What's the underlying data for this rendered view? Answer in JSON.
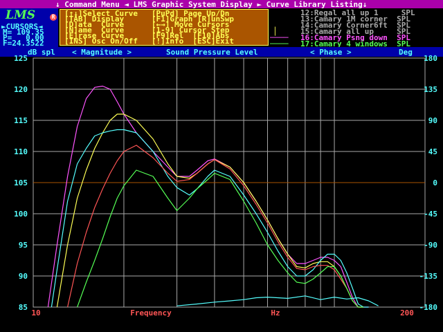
{
  "titlebar": {
    "text": "↓ Command Menu ◄ LMS Graphic System Display ► Curve Library Listing↓"
  },
  "logo": {
    "text": "LMS",
    "mark": "R"
  },
  "cursors": {
    "header": "►CURSORS◄",
    "m": "M= 109.35",
    "p": "P=   0.00",
    "f": "F=24.3522"
  },
  "command_menu": [
    "[↑↓]Select Curve   [PuPd] Page Up/Dn",
    "[TAB] Display      [F1]Graph [R]unSwp",
    "[D]ata  Curve      [←→] Move Cursors",
    "[N]ame  Curve      [1-9] Cursor Step",
    "[E]rase Curve      [F9]Rel  [F10]Abs",
    "[INS] Osc On/Off   [!]Info  [ESC]Exit"
  ],
  "library": [
    {
      "text": "12:Regal all up 1     SPL",
      "color": "#aaaaaa",
      "marker": ""
    },
    {
      "text": "13:Camary 1M corner  SPL",
      "color": "#aaaaaa",
      "marker": ""
    },
    {
      "text": "14:Camary Corner6ft  SPL",
      "color": "#aaaaaa",
      "marker": ""
    },
    {
      "text": "15:Camary all up     SPL",
      "color": "#aaaaaa",
      "marker": "│"
    },
    {
      "text": "16:Camary Psng down  SPL",
      "color": "#ff55ff",
      "marker": "────"
    },
    {
      "text": "17:Camary 4 windows  SPL",
      "color": "#55ff55",
      "marker": "────"
    }
  ],
  "magbar": {
    "left_unit": "dB spl",
    "magnitude": "< Magnitude >",
    "title": "Sound Pressure Level",
    "phase": "< Phase >",
    "right_unit": "Deg"
  },
  "chart_data": {
    "type": "line",
    "title": "Sound Pressure Level",
    "xlabel": "Frequency",
    "xunit": "Hz",
    "ylabel": "dB spl",
    "y2label": "Deg",
    "xscale": "log",
    "xlim": [
      10,
      200
    ],
    "ylim": [
      85,
      125
    ],
    "y2lim": [
      -180,
      180
    ],
    "x_tick_labels": [
      "10",
      "200"
    ],
    "y_ticks": [
      85,
      90,
      95,
      100,
      105,
      110,
      115,
      120,
      125
    ],
    "y2_ticks": [
      180,
      135,
      90,
      45,
      0,
      -45,
      -90,
      -135,
      -180
    ],
    "reference_level": 105,
    "grid": true,
    "series": [
      {
        "color": "#ff55ff",
        "x": [
          11.2,
          12,
          13,
          14,
          15,
          16,
          17,
          18,
          19,
          20,
          22,
          25,
          28,
          30,
          33,
          35,
          38,
          40,
          45,
          50,
          55,
          60,
          65,
          70,
          75,
          80,
          85,
          90,
          95,
          100,
          105,
          110,
          115,
          120,
          125,
          130
        ],
        "y": [
          85,
          95,
          106,
          114,
          118.5,
          120.3,
          120.5,
          120,
          118,
          116,
          113,
          110,
          107.5,
          106,
          106,
          107,
          108.5,
          108.8,
          107.5,
          105,
          102,
          99,
          96,
          93.5,
          92,
          92,
          92.5,
          93,
          93,
          92.5,
          91.5,
          89,
          86.5,
          85,
          85,
          85
        ]
      },
      {
        "color": "#ffff55",
        "x": [
          12,
          13,
          14,
          15,
          16,
          17,
          18,
          19,
          20,
          22,
          25,
          28,
          30,
          33,
          35,
          38,
          40,
          45,
          50,
          55,
          60,
          65,
          70,
          75,
          80,
          85,
          90,
          95,
          100,
          105,
          110,
          115,
          120,
          125
        ],
        "y": [
          85,
          95,
          102.5,
          107,
          110.5,
          113,
          115,
          116,
          116,
          115,
          112,
          108,
          106,
          105.7,
          106.5,
          108,
          108.7,
          107.5,
          105,
          102,
          99,
          96,
          93.5,
          91.5,
          91.3,
          92,
          92.3,
          92.3,
          91.5,
          90,
          88,
          86,
          85,
          85
        ]
      },
      {
        "color": "#55ffff",
        "x": [
          11.5,
          12,
          13,
          14,
          15,
          16,
          17,
          18,
          19,
          20,
          22,
          25,
          28,
          30,
          33,
          35,
          38,
          40,
          45,
          50,
          55,
          60,
          65,
          70,
          75,
          80,
          85,
          90,
          95,
          100,
          105,
          110,
          115,
          120,
          125,
          130
        ],
        "y": [
          85,
          91,
          102,
          108,
          110.5,
          112.5,
          113,
          113.3,
          113.5,
          113.5,
          113,
          110,
          106,
          104.2,
          103,
          104,
          106,
          107,
          106,
          103,
          100,
          97,
          94,
          91.5,
          90,
          90,
          91,
          92.5,
          93.5,
          93.5,
          92.5,
          90.5,
          88,
          85.5,
          85,
          85
        ]
      },
      {
        "color": "#ff5555",
        "x": [
          13,
          14,
          15,
          16,
          17,
          18,
          19,
          20,
          22,
          25,
          28,
          30,
          33,
          35,
          38,
          40,
          45,
          50,
          55,
          60,
          65,
          70,
          75,
          80,
          85,
          90,
          95,
          100,
          105,
          110,
          115,
          120,
          125
        ],
        "y": [
          85,
          92,
          97,
          101,
          104,
          106.5,
          108.5,
          110,
          111,
          109,
          106.5,
          105.2,
          105.5,
          106.5,
          108,
          108.7,
          107.2,
          104.5,
          101.5,
          98.5,
          95.5,
          93,
          91.2,
          91,
          91.5,
          91.7,
          91.7,
          91,
          89.5,
          88,
          86,
          85,
          85
        ]
      },
      {
        "color": "#55ff55",
        "x": [
          14,
          15,
          16,
          17,
          18,
          19,
          20,
          22,
          25,
          28,
          30,
          33,
          35,
          38,
          40,
          45,
          50,
          55,
          60,
          65,
          70,
          75,
          80,
          85,
          90,
          95,
          100,
          105,
          110,
          115,
          120,
          125
        ],
        "y": [
          85,
          89,
          92.5,
          96,
          99.5,
          102.5,
          104.5,
          107,
          106,
          102.5,
          100.5,
          102.5,
          104,
          105.5,
          106.5,
          105.5,
          102,
          98.5,
          95,
          92.5,
          90.5,
          89,
          88.8,
          89.5,
          90.5,
          91.5,
          91.5,
          90,
          88,
          86,
          85,
          85
        ]
      },
      {
        "color": "#55ffff",
        "x": [
          30,
          35,
          40,
          45,
          50,
          55,
          60,
          70,
          80,
          90,
          100,
          110,
          120,
          130,
          140
        ],
        "y": [
          85.2,
          85.5,
          85.8,
          86,
          86.2,
          86.5,
          86.6,
          86.4,
          86.8,
          86.2,
          86.6,
          86.3,
          86.5,
          86,
          85.2
        ]
      }
    ]
  }
}
